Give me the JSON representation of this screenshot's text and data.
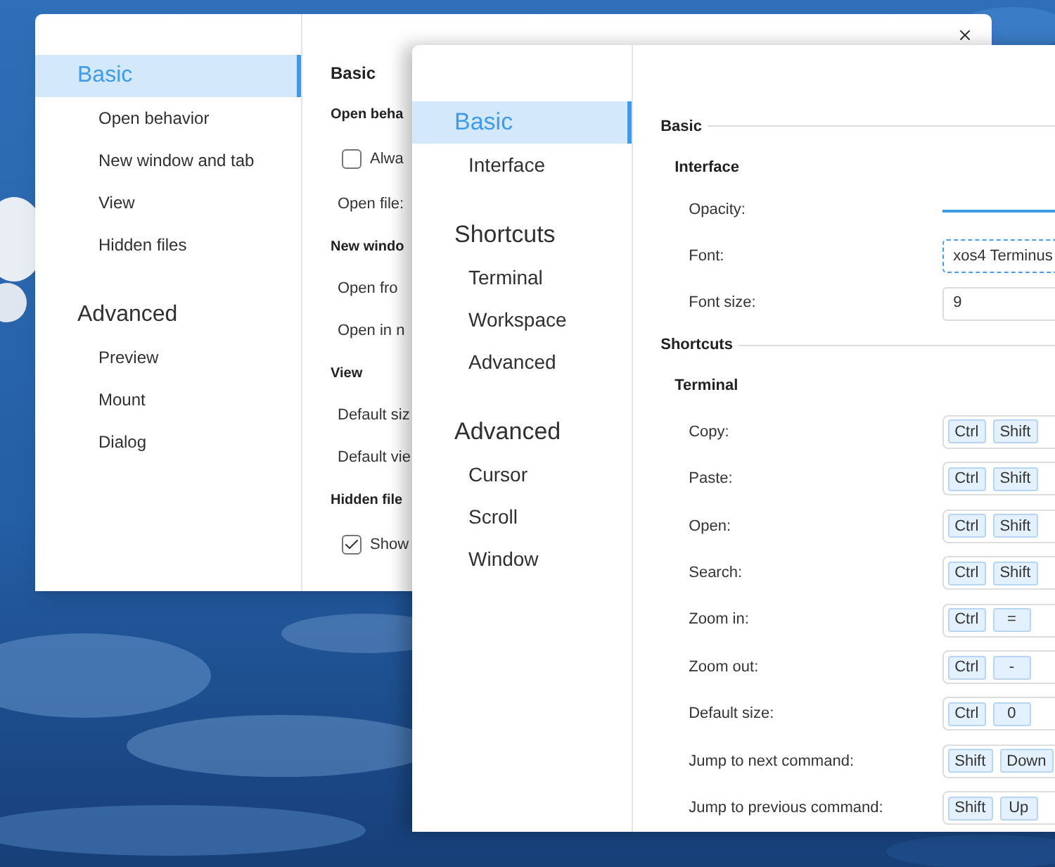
{
  "back_window": {
    "sidebar": [
      {
        "kind": "heading",
        "label": "Basic",
        "selected": true
      },
      {
        "kind": "item",
        "label": "Open behavior",
        "selected": false
      },
      {
        "kind": "item",
        "label": "New window and tab",
        "selected": false
      },
      {
        "kind": "item",
        "label": "View",
        "selected": false
      },
      {
        "kind": "item",
        "label": "Hidden files",
        "selected": false
      },
      {
        "kind": "heading",
        "label": "Advanced",
        "selected": false
      },
      {
        "kind": "item",
        "label": "Preview",
        "selected": false
      },
      {
        "kind": "item",
        "label": "Mount",
        "selected": false
      },
      {
        "kind": "item",
        "label": "Dialog",
        "selected": false
      }
    ],
    "content": [
      {
        "kind": "section",
        "text": "Basic"
      },
      {
        "kind": "group",
        "text": "Open beha"
      },
      {
        "kind": "checkbox",
        "text": "Alwa",
        "checked": false
      },
      {
        "kind": "label",
        "text": "Open file:"
      },
      {
        "kind": "group",
        "text": "New windo"
      },
      {
        "kind": "label",
        "text": "Open fro"
      },
      {
        "kind": "label",
        "text": "Open in n"
      },
      {
        "kind": "group",
        "text": "View"
      },
      {
        "kind": "label",
        "text": "Default siz"
      },
      {
        "kind": "label",
        "text": "Default vie"
      },
      {
        "kind": "group",
        "text": "Hidden file"
      },
      {
        "kind": "checkbox",
        "text": "Show",
        "checked": true
      }
    ]
  },
  "front_window": {
    "sidebar": [
      {
        "kind": "heading",
        "label": "Basic",
        "selected": true
      },
      {
        "kind": "item",
        "label": "Interface",
        "selected": false
      },
      {
        "kind": "heading",
        "label": "Shortcuts",
        "selected": false
      },
      {
        "kind": "item",
        "label": "Terminal",
        "selected": false
      },
      {
        "kind": "item",
        "label": "Workspace",
        "selected": false
      },
      {
        "kind": "item",
        "label": "Advanced",
        "selected": false
      },
      {
        "kind": "heading",
        "label": "Advanced",
        "selected": false
      },
      {
        "kind": "item",
        "label": "Cursor",
        "selected": false
      },
      {
        "kind": "item",
        "label": "Scroll",
        "selected": false
      },
      {
        "kind": "item",
        "label": "Window",
        "selected": false
      }
    ],
    "content": [
      {
        "kind": "section",
        "text": "Basic"
      },
      {
        "kind": "group",
        "text": "Interface"
      },
      {
        "kind": "slider",
        "label": "Opacity:"
      },
      {
        "kind": "combo",
        "label": "Font:",
        "value": "xos4 Terminus"
      },
      {
        "kind": "input",
        "label": "Font size:",
        "value": "9"
      },
      {
        "kind": "section",
        "text": "Shortcuts"
      },
      {
        "kind": "group",
        "text": "Terminal"
      },
      {
        "kind": "shortcut",
        "label": "Copy:",
        "keys": [
          "Ctrl",
          "Shift"
        ]
      },
      {
        "kind": "shortcut",
        "label": "Paste:",
        "keys": [
          "Ctrl",
          "Shift"
        ]
      },
      {
        "kind": "shortcut",
        "label": "Open:",
        "keys": [
          "Ctrl",
          "Shift"
        ]
      },
      {
        "kind": "shortcut",
        "label": "Search:",
        "keys": [
          "Ctrl",
          "Shift"
        ]
      },
      {
        "kind": "shortcut",
        "label": "Zoom in:",
        "keys": [
          "Ctrl",
          "="
        ]
      },
      {
        "kind": "shortcut",
        "label": "Zoom out:",
        "keys": [
          "Ctrl",
          "-"
        ]
      },
      {
        "kind": "shortcut",
        "label": "Default size:",
        "keys": [
          "Ctrl",
          "0"
        ]
      },
      {
        "kind": "shortcut",
        "label": "Jump to next command:",
        "keys": [
          "Shift",
          "Down"
        ]
      },
      {
        "kind": "shortcut",
        "label": "Jump to previous command:",
        "keys": [
          "Shift",
          "Up"
        ]
      }
    ]
  }
}
